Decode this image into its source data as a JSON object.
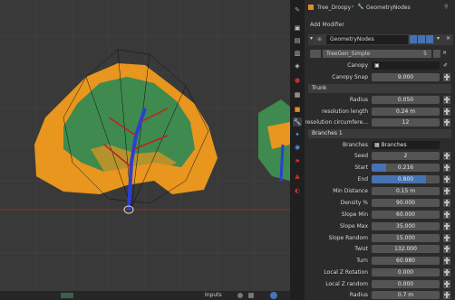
{
  "header": {
    "object_name": "Tree_Droopy",
    "modifier_name": "GeometryNodes",
    "add_modifier": "Add Modifier"
  },
  "modifier": {
    "name": "GeometryNodes",
    "node_group": "TreeGen_Simple",
    "users": "5"
  },
  "params": {
    "canopy_label": "Canopy",
    "canopy_snap_label": "Canopy Snap",
    "canopy_snap": "9.000",
    "trunk_section": "Trunk",
    "radius_label": "Radius",
    "radius": "0.050",
    "res_length_label": "resolution length",
    "res_length": "0.24 m",
    "res_circ_label": "resolution circumfere...",
    "res_circ": "12",
    "branches_section": "Branches 1",
    "branches_label": "Branches",
    "branches_value": "Branches",
    "seed_label": "Seed",
    "seed": "2",
    "start_label": "Start",
    "start": "0.216",
    "start_fraction": 0.216,
    "end_label": "End",
    "end": "0.800",
    "end_fraction": 0.8,
    "min_dist_label": "Min Distance",
    "min_dist": "0.15 m",
    "density_label": "Density %",
    "density": "90.000",
    "slope_min_label": "Slope Min",
    "slope_min": "60.000",
    "slope_max_label": "Slope Max",
    "slope_max": "35.000",
    "slope_random_label": "Slope Random",
    "slope_random": "15.000",
    "twist_label": "Twist",
    "twist": "132.000",
    "turn_label": "Turn",
    "turn": "60.980",
    "local_z_rot_label": "Local Z Rotation",
    "local_z_rot": "0.000",
    "local_z_random_label": "Local Z random",
    "local_z_random": "0.000",
    "radius2_label": "Radius",
    "radius2": "0.7 m"
  },
  "footer": {
    "inputs_label": "Inputs"
  },
  "colors": {
    "foliage_orange": "#e8961e",
    "foliage_green": "#3f8a4e",
    "trunk_blue": "#2a3fd6",
    "accent_blue": "#4772b3"
  }
}
